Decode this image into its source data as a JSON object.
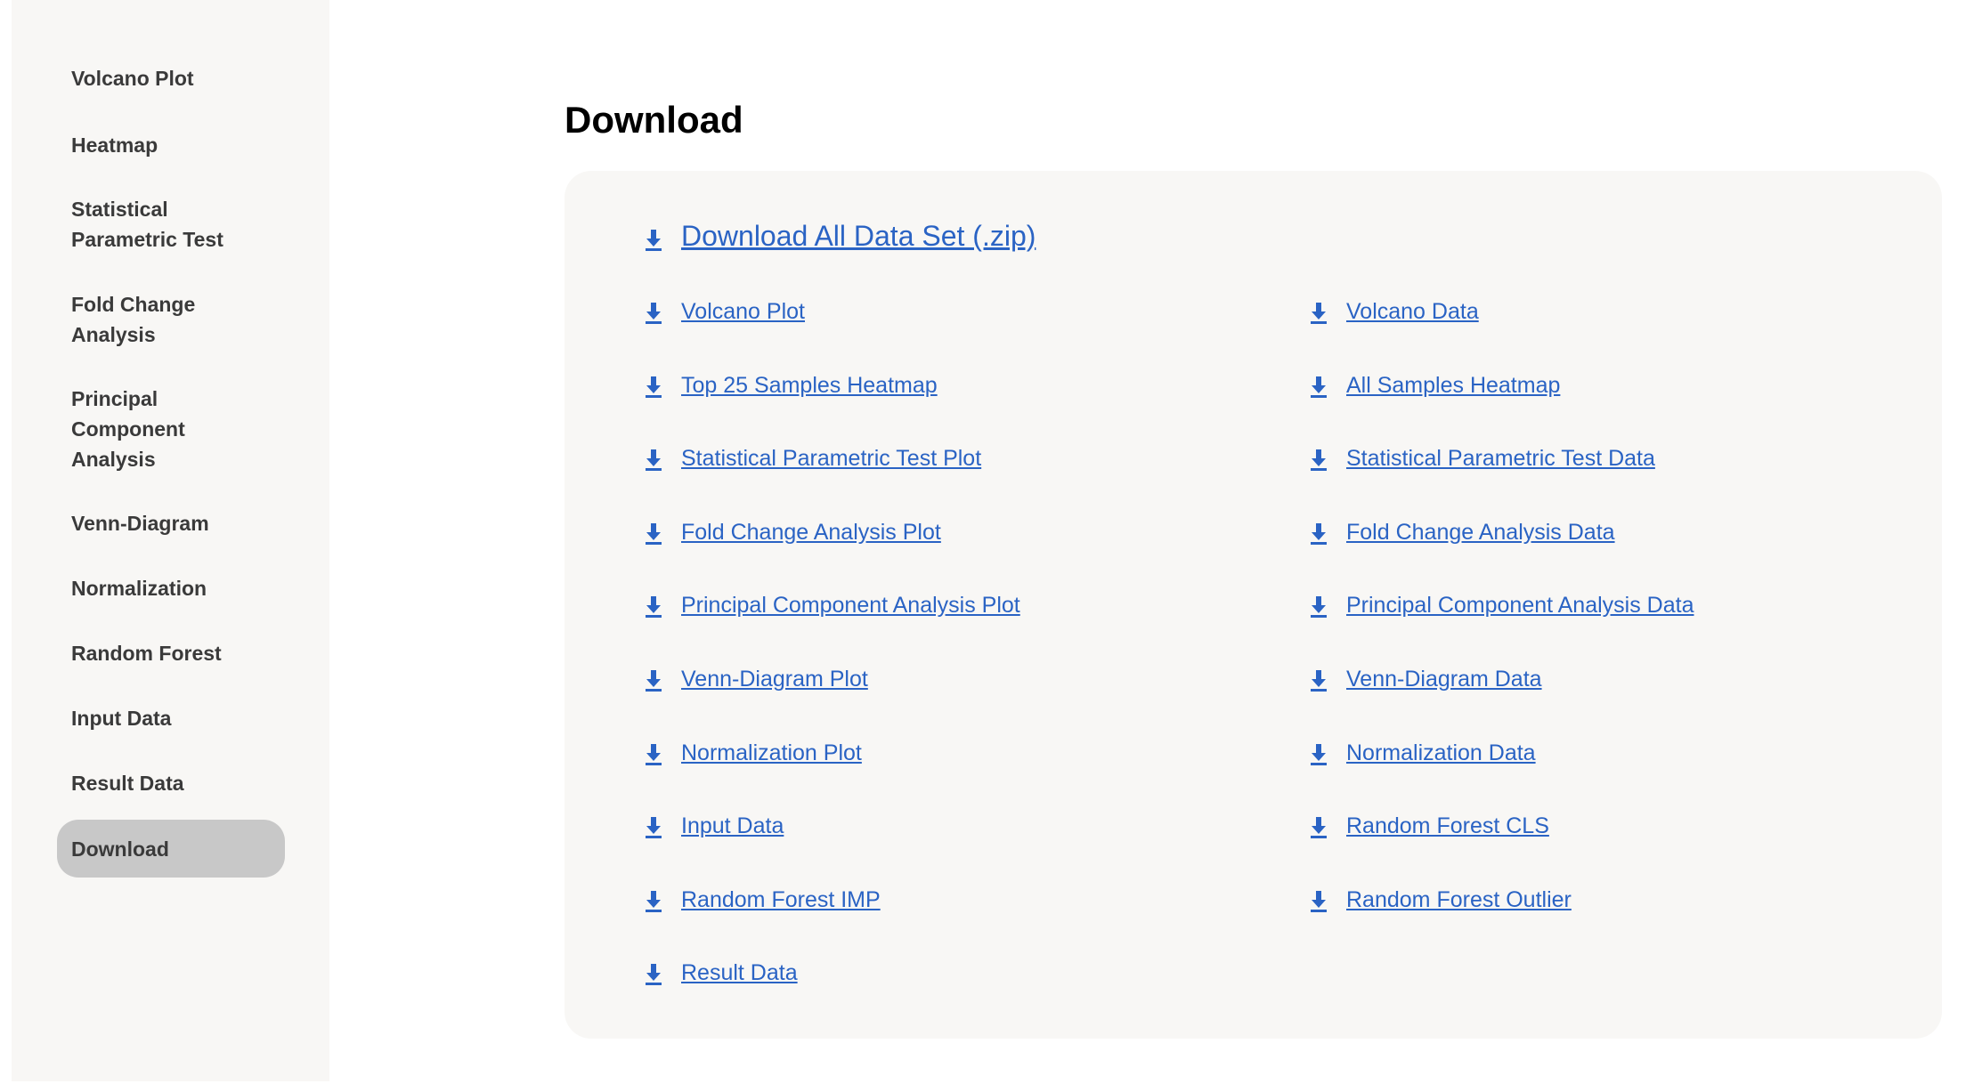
{
  "sidebar": {
    "items": [
      {
        "label": "Volcano Plot"
      },
      {
        "label": "Heatmap"
      },
      {
        "label": "Statistical Parametric Test"
      },
      {
        "label": "Fold Change Analysis"
      },
      {
        "label": "Principal Component Analysis"
      },
      {
        "label": "Venn-Diagram"
      },
      {
        "label": "Normalization"
      },
      {
        "label": "Random Forest"
      },
      {
        "label": "Input Data"
      },
      {
        "label": "Result Data"
      },
      {
        "label": "Download",
        "active": true
      }
    ]
  },
  "main": {
    "title": "Download",
    "download_all": "Download All Data Set (.zip)",
    "left_links": [
      "Volcano Plot",
      "Top 25 Samples Heatmap",
      "Statistical Parametric Test Plot",
      "Fold Change Analysis Plot",
      "Principal Component Analysis Plot",
      "Venn-Diagram Plot",
      "Normalization Plot",
      "Input Data",
      "Random Forest IMP",
      "Result Data"
    ],
    "right_links": [
      "Volcano Data",
      "All Samples Heatmap",
      "Statistical Parametric Test Data",
      "Fold Change Analysis Data",
      "Principal Component Analysis Data",
      "Venn-Diagram Data",
      "Normalization Data",
      "Random Forest CLS",
      "Random Forest Outlier"
    ],
    "icon": "download-icon",
    "link_color": "#2a63c4"
  }
}
